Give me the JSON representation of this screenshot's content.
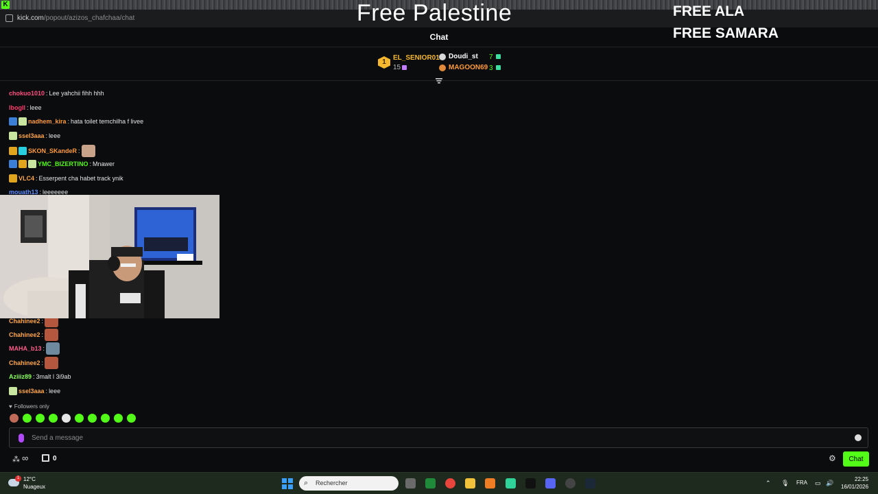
{
  "browser": {
    "url_domain": "kick.com",
    "url_path": "/popout/azizos_chafchaa/chat"
  },
  "overlay": {
    "title": "Free Palestine",
    "free_ala": "FREE ALA",
    "free_samara": "FREE SAMARA"
  },
  "chat_header": {
    "title": "Chat"
  },
  "leaderboard": {
    "rank1_number": "1",
    "first": {
      "name": "EL_SENIOR01",
      "count": "15"
    },
    "second": {
      "name": "Doudi_st",
      "count": "7"
    },
    "third": {
      "name": "MAGOON69",
      "count": "3"
    }
  },
  "messages": [
    {
      "user": "chokuo1010",
      "text": "Lee yahchii fihh hhh",
      "color": "#ff4f7e"
    },
    {
      "user": "lbogll",
      "text": "leee",
      "color": "#ff3d6e"
    },
    {
      "user": "nadhem_kira",
      "text": "hata toilet temchilha f livee",
      "color": "#ff9b3d"
    },
    {
      "user": "ssel3aaa",
      "text": "leee",
      "color": "#ffa64d"
    },
    {
      "user": "SKON_SKandeR",
      "text": "",
      "color": "#ff9b3d"
    },
    {
      "user": "YMC_BIZERTINO",
      "text": "Mnawer",
      "color": "#53fc18"
    },
    {
      "user": "VLC4",
      "text": "Esserpent cha habet track ynik",
      "color": "#ffa64d"
    },
    {
      "user": "mouath13",
      "text": "leeeeeee",
      "color": "#5b8cff"
    },
    {
      "user": "Chahinee2",
      "text": "",
      "color": "#ffa64d"
    },
    {
      "user": "Chahinee2",
      "text": "",
      "color": "#ffa64d"
    },
    {
      "user": "MAHA_b13",
      "text": "",
      "color": "#ff5c8a"
    },
    {
      "user": "Chahinee2",
      "text": "",
      "color": "#ffa64d"
    },
    {
      "user": "Aziiiz89",
      "text": "3malt l 3i9ab",
      "color": "#8aff5c"
    },
    {
      "user": "ssel3aaa",
      "text": "leee",
      "color": "#ffa64d"
    }
  ],
  "followers_only": "Followers only",
  "composer": {
    "placeholder": "Send a message"
  },
  "bottom": {
    "count": "0",
    "chat_button": "Chat",
    "infinity": "∞"
  },
  "taskbar": {
    "weather_temp": "12°C",
    "weather_condition": "Nuageux",
    "weather_badge": "1",
    "search_label": "Rechercher",
    "language": "FRA",
    "time": "22:25",
    "date": "16/01/2026"
  },
  "colors": {
    "accent": "#53fc18",
    "background": "#0b0c0e"
  }
}
